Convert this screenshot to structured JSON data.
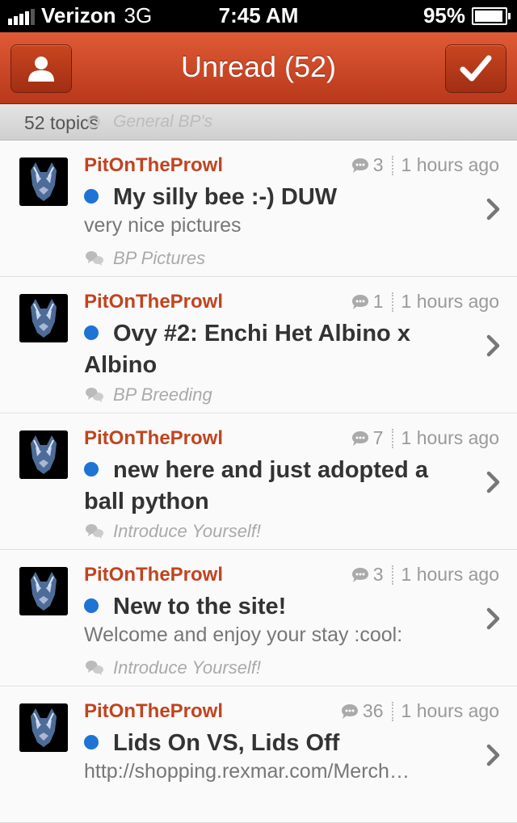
{
  "status_bar": {
    "carrier": "Verizon",
    "network": "3G",
    "time": "7:45 AM",
    "battery": "95%"
  },
  "nav": {
    "title": "Unread (52)",
    "left_icon": "person-icon",
    "right_icon": "checkmark-icon"
  },
  "subheader": {
    "count": "52 topics",
    "forum": "General BP's"
  },
  "topics": [
    {
      "author": "PitOnTheProwl",
      "replies": "3",
      "time": "1 hours ago",
      "title": "My silly bee :-)  DUW",
      "preview": "very nice pictures",
      "forum": "BP Pictures"
    },
    {
      "author": "PitOnTheProwl",
      "replies": "1",
      "time": "1 hours ago",
      "title": "Ovy #2:  Enchi Het Albino x Albino",
      "preview": "",
      "forum": "BP Breeding"
    },
    {
      "author": "PitOnTheProwl",
      "replies": "7",
      "time": "1 hours ago",
      "title": "new here and just adopted a ball python",
      "preview": "",
      "forum": "Introduce Yourself!"
    },
    {
      "author": "PitOnTheProwl",
      "replies": "3",
      "time": "1 hours ago",
      "title": "New to the site!",
      "preview": "Welcome and enjoy your stay :cool:",
      "forum": "Introduce Yourself!"
    },
    {
      "author": "PitOnTheProwl",
      "replies": "36",
      "time": "1 hours ago",
      "title": "Lids On VS, Lids Off",
      "preview": "http://shopping.rexmar.com/Merch…",
      "forum": ""
    }
  ],
  "colors": {
    "accent": "#c1441f",
    "unread_dot": "#1e73d4",
    "navbar": "#c8461f"
  }
}
